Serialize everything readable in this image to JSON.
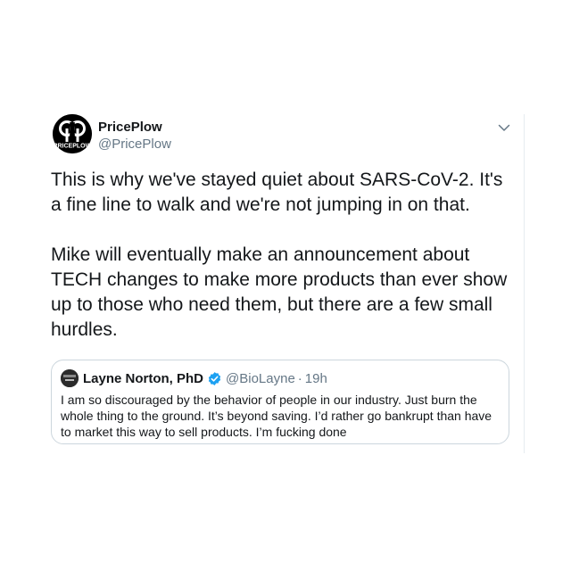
{
  "tweet": {
    "display_name": "PricePlow",
    "handle": "@PricePlow",
    "avatar_text": "PRICEPLOW",
    "paragraphs": [
      "This is why we've stayed quiet about SARS-CoV-2. It's a fine line to walk and we're not jumping in on that.",
      "Mike will eventually make an announcement about TECH changes to make more products than ever show up to those who need them, but there are a few small hurdles."
    ]
  },
  "quote": {
    "display_name": "Layne Norton, PhD",
    "handle": "@BioLayne",
    "separator": "·",
    "time": "19h",
    "text": "I am so discouraged by the behavior of people in our industry. Just burn the whole thing to the ground. It’s beyond saving. I’d rather go bankrupt than have to market this way to sell products. I’m fucking done"
  },
  "icons": {
    "verified": "verified-badge-icon",
    "more": "chevron-down-icon"
  },
  "colors": {
    "text": "#14171a",
    "secondary": "#657786",
    "verified_blue": "#1da1f2",
    "border": "#ccd6dd"
  }
}
